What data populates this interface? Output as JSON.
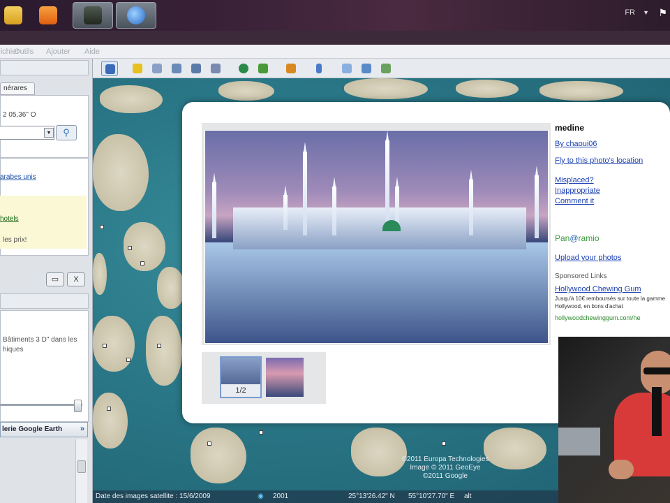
{
  "taskbar": {
    "language": "FR"
  },
  "menu": {
    "items": [
      "Fichier",
      "Outils",
      "Ajouter",
      "Aide"
    ]
  },
  "sidebar": {
    "tab_label": "nérares",
    "coordinates": "2 05,36\" O",
    "result_link": "arabes unis",
    "ad_link": "hotels",
    "ad_text": "les prix!",
    "close_button": "X",
    "layers_text_1": "Bâtiments 3 D\" dans les",
    "layers_text_2": "hiques",
    "gallery_label": "lerie Google Earth",
    "gallery_chevron": "»"
  },
  "photo_balloon": {
    "title": "medine",
    "author_link": "By chaoui06",
    "fly_link": "Fly to this photo's location",
    "misplaced_link": "Misplaced?",
    "inappropriate_link": "Inappropriate",
    "comment_link": "Comment it",
    "panoramio_a": "Pan",
    "panoramio_b": "@",
    "panoramio_c": "ramio",
    "upload_link": "Upload your photos",
    "sponsored_label": "Sponsored Links",
    "ad_title": "Hollywood Chewing Gum",
    "ad_desc": "Jusqu'à 10€ remboursés sur toute la gamme Hollywood, en bons d'achat",
    "ad_url": "hollywoodchewinggum.com/he",
    "thumbnail_counter": "1/2"
  },
  "map": {
    "status_date": "Date des images satellite : 15/6/2009",
    "status_year": "2001",
    "status_lat": "25°13'26.42\" N",
    "status_lon": "55°10'27.70\" E",
    "status_alt": "alt",
    "copyright_1": "©2011 Europa Technologies",
    "copyright_2": "Image © 2011 GeoEye",
    "copyright_3": "©2011 Google"
  },
  "colors": {
    "link": "#1a3fb0",
    "panoramio_green": "#3a9a3a",
    "ad_url_green": "#2a8a2a",
    "water": "#2a7888"
  }
}
